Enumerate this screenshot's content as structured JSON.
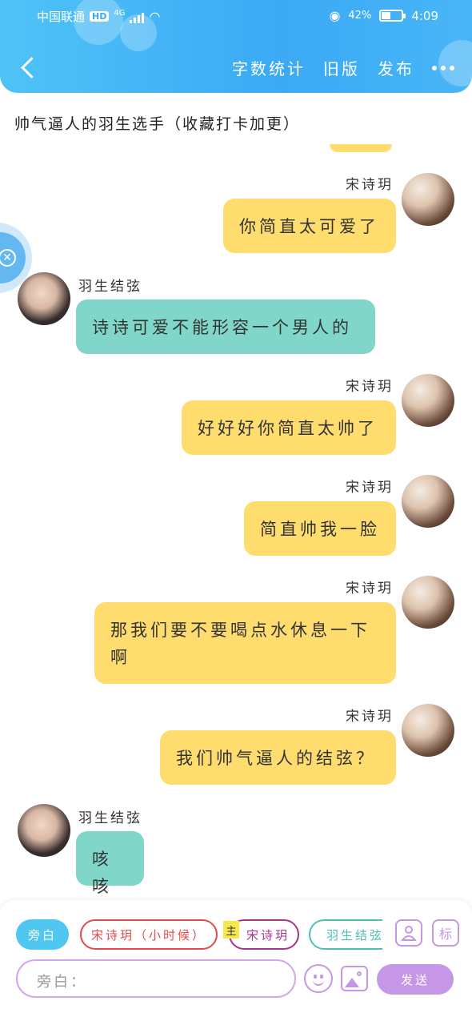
{
  "status_bar": {
    "carrier": "中国联通",
    "hd": "HD",
    "network": "4G",
    "battery": "42%",
    "time": "4:09"
  },
  "nav": {
    "word_count": "字数统计",
    "old_version": "旧版",
    "publish": "发布"
  },
  "story_title": "帅气逼人的羽生选手（收藏打卡加更）",
  "messages": [
    {
      "sender": "宋诗玥",
      "text": "你简直太可爱了",
      "side": "right"
    },
    {
      "sender": "羽生结弦",
      "text": "诗诗可爱不能形容一个男人的",
      "side": "left"
    },
    {
      "sender": "宋诗玥",
      "text": "好好好你简直太帅了",
      "side": "right"
    },
    {
      "sender": "宋诗玥",
      "text": "简直帅我一脸",
      "side": "right"
    },
    {
      "sender": "宋诗玥",
      "text": "那我们要不要喝点水休息一下啊",
      "side": "right"
    },
    {
      "sender": "宋诗玥",
      "text": "我们帅气逼人的结弦？",
      "side": "right"
    },
    {
      "sender": "羽生结弦",
      "text": "咳咳",
      "side": "left"
    }
  ],
  "composer": {
    "roles": [
      {
        "label": "旁白",
        "color": "#4fc7f0"
      },
      {
        "label": "宋诗玥（小时候）",
        "color": "#e24a4a"
      },
      {
        "label": "宋诗玥",
        "color": "#a4358f",
        "main_tag": "主"
      },
      {
        "label": "羽生结弦",
        "color": "#4dbfb8"
      }
    ],
    "tag_icon": "标",
    "input_placeholder": "旁白：",
    "send": "发送"
  },
  "colors": {
    "header": "#3ba9f5",
    "my_bubble": "#ffdc6e",
    "other_bubble": "#7fd6c9",
    "accent": "#c597e6"
  },
  "icons": [
    "back-icon",
    "more-icon",
    "contact-icon",
    "emoji-icon",
    "image-icon",
    "eye-icon",
    "wifi-icon",
    "signal-icon",
    "battery-icon"
  ]
}
